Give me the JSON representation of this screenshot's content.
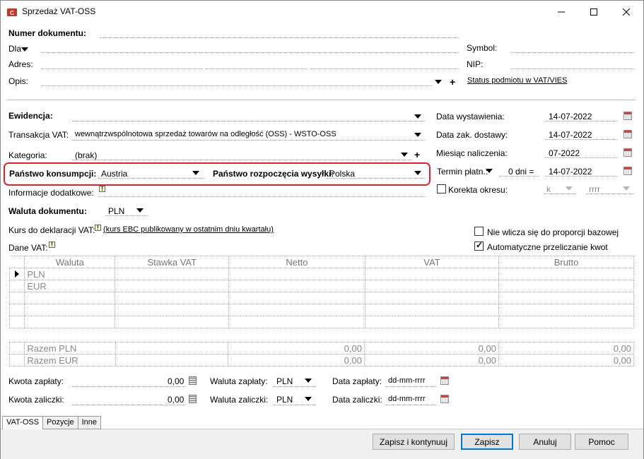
{
  "window": {
    "title": "Sprzedaż VAT-OSS"
  },
  "header": {
    "numer_label": "Numer dokumentu:",
    "dla_label": "Dla",
    "adres_label": "Adres:",
    "opis_label": "Opis:",
    "symbol_label": "Symbol:",
    "nip_label": "NIP:",
    "status_link": "Status podmiotu w VAT/VIES"
  },
  "form": {
    "ewidencja_label": "Ewidencja:",
    "transakcja_label": "Transakcja VAT:",
    "transakcja_value": "wewnątrzwspólnotowa sprzedaż towarów na odległość (OSS) - WSTO-OSS",
    "kategoria_label": "Kategoria:",
    "kategoria_value": "(brak)",
    "panstwo_konsumpcji_label": "Państwo konsumpcji:",
    "panstwo_konsumpcji_value": "Austria",
    "panstwo_wysylki_label": "Państwo rozpoczęcia wysyłki:",
    "panstwo_wysylki_value": "Polska",
    "informacje_label": "Informacje dodatkowe:",
    "waluta_label": "Waluta dokumentu:",
    "waluta_value": "PLN",
    "kurs_label": "Kurs do deklaracji VAT:",
    "kurs_link": "(kurs EBC publikowany w ostatnim dniu kwartału)",
    "dane_vat_label": "Dane VAT:"
  },
  "dates": {
    "data_wystawienia_label": "Data wystawienia:",
    "data_wystawienia_value": "14-07-2022",
    "data_dostawy_label": "Data zak. dostawy:",
    "data_dostawy_value": "14-07-2022",
    "miesiac_label": "Miesiąc naliczenia:",
    "miesiac_value": "07-2022",
    "termin_label": "Termin płatn.:",
    "termin_days": "0 dni =",
    "termin_value": "14-07-2022",
    "korekta_label": "Korekta okresu:",
    "korekta_k": "k",
    "korekta_rrrr": "rrrr"
  },
  "options": {
    "nie_wlicza_label": "Nie wlicza się do proporcji bazowej",
    "nie_wlicza_checked": false,
    "automatyczne_label": "Automatyczne przeliczanie kwot",
    "automatyczne_checked": true
  },
  "vat_table": {
    "columns": [
      "Waluta",
      "Stawka VAT",
      "Netto",
      "VAT",
      "Brutto"
    ],
    "rows": [
      "PLN",
      "EUR",
      "",
      "",
      ""
    ]
  },
  "totals": [
    {
      "label": "Razem PLN",
      "netto": "0,00",
      "vat": "0,00",
      "brutto": "0,00"
    },
    {
      "label": "Razem EUR",
      "netto": "0,00",
      "vat": "0,00",
      "brutto": "0,00"
    }
  ],
  "payment": {
    "kwota_zaplaty_label": "Kwota zapłaty:",
    "kwota_zaplaty_value": "0,00",
    "kwota_zaliczki_label": "Kwota zaliczki:",
    "kwota_zaliczki_value": "0,00",
    "waluta_zaplaty_label": "Waluta zapłaty:",
    "waluta_zaplaty_value": "PLN",
    "waluta_zaliczki_label": "Waluta zaliczki:",
    "waluta_zaliczki_value": "PLN",
    "data_zaplaty_label": "Data zapłaty:",
    "data_zaplaty_value": "dd-mm-rrrr",
    "data_zaliczki_label": "Data zaliczki:",
    "data_zaliczki_value": "dd-mm-rrrr"
  },
  "tabs": [
    "VAT-OSS",
    "Pozycje",
    "Inne"
  ],
  "buttons": {
    "zapisz_kontynuuj": "Zapisz i kontynuuj",
    "zapisz": "Zapisz",
    "anuluj": "Anuluj",
    "pomoc": "Pomoc"
  },
  "colors": {
    "highlight": "#e0222a",
    "accent": "#0078d7"
  }
}
